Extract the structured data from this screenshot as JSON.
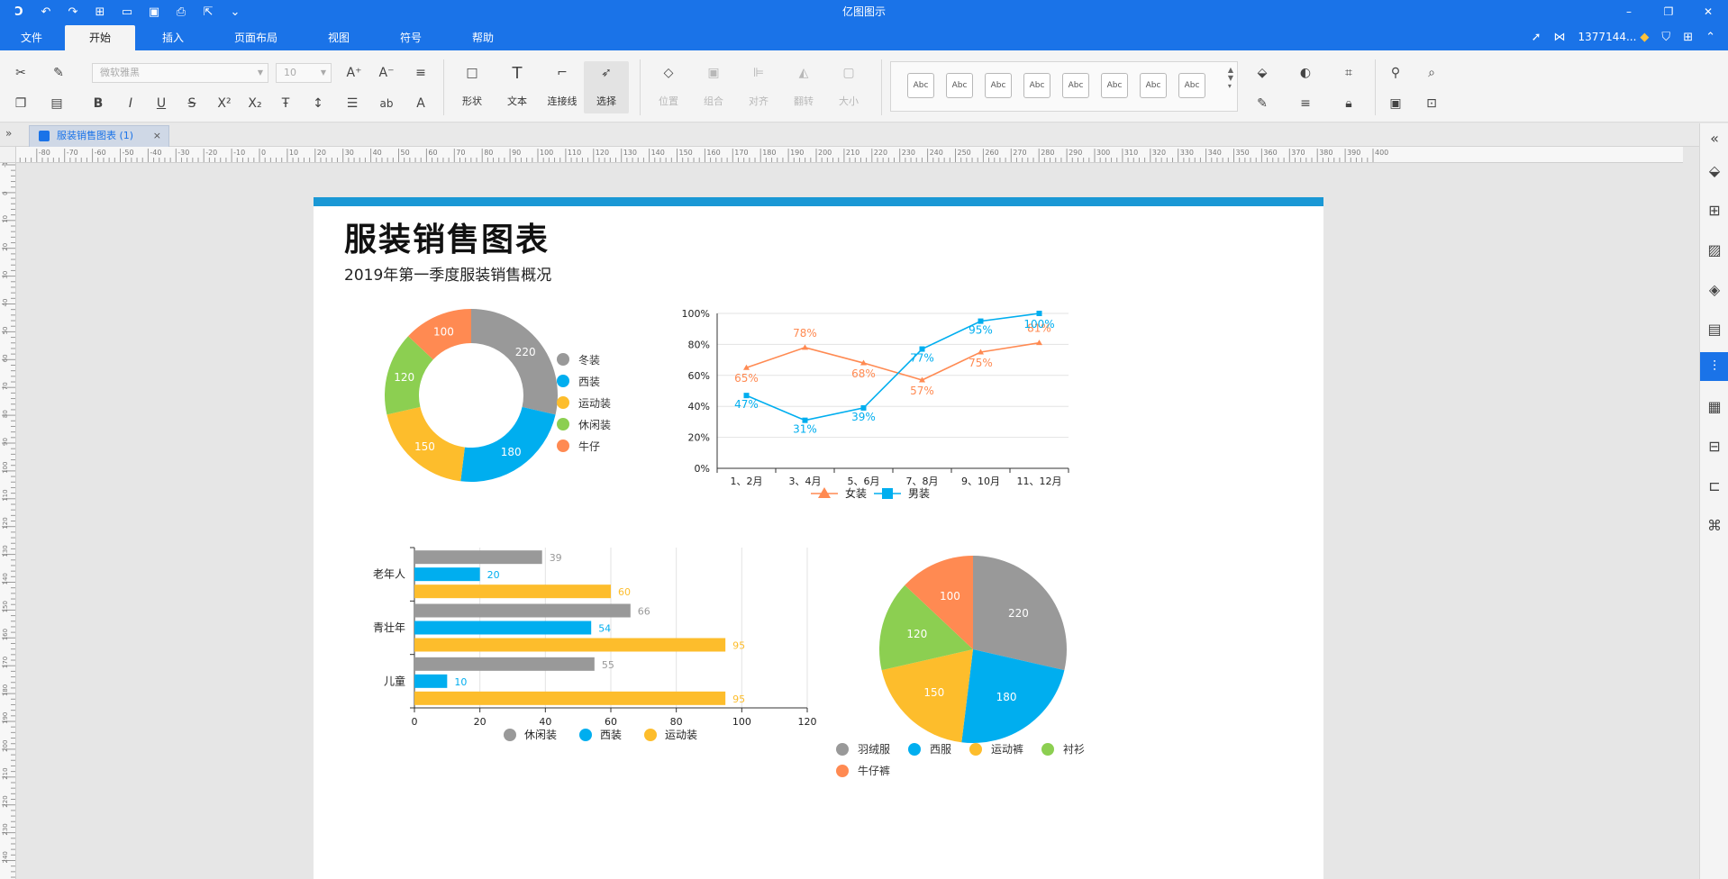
{
  "app": {
    "title": "亿图图示",
    "user": "1377144..."
  },
  "menu": {
    "tabs": [
      "文件",
      "开始",
      "插入",
      "页面布局",
      "视图",
      "符号",
      "帮助"
    ],
    "active": "开始"
  },
  "ribbon": {
    "font_name": "微软雅黑",
    "font_size": "10",
    "tools": {
      "shape": "形状",
      "text": "文本",
      "connector": "连接线",
      "select": "选择",
      "position": "位置",
      "group": "组合",
      "align": "对齐",
      "rotate": "翻转",
      "size": "大小"
    },
    "style_swatch_label": "Abc",
    "style_swatch_count": 8
  },
  "document": {
    "tab_title": "服装销售图表 (1)"
  },
  "page": {
    "title": "服装销售图表",
    "subtitle": "2019年第一季度服装销售概况"
  },
  "colors": {
    "gray": "#999999",
    "blue": "#00aeef",
    "yellow": "#fdbd2c",
    "green": "#8ccf51",
    "orange": "#ff8a52",
    "accent": "#1a73e8"
  },
  "chart_data": [
    {
      "type": "pie",
      "variant": "donut",
      "categories": [
        "冬装",
        "西装",
        "运动装",
        "休闲装",
        "牛仔"
      ],
      "values": [
        220,
        180,
        150,
        120,
        100
      ]
    },
    {
      "type": "line",
      "categories": [
        "1、2月",
        "3、4月",
        "5、6月",
        "7、8月",
        "9、10月",
        "11、12月"
      ],
      "series": [
        {
          "name": "女装",
          "values": [
            65,
            78,
            68,
            57,
            75,
            81
          ]
        },
        {
          "name": "男装",
          "values": [
            47,
            31,
            39,
            77,
            95,
            100
          ]
        }
      ],
      "ylim": [
        0,
        100
      ],
      "yticks": [
        "0%",
        "20%",
        "40%",
        "60%",
        "80%",
        "100%"
      ],
      "data_labels": [
        "65%",
        "78%",
        "68%",
        "57%",
        "75%",
        "81%",
        "47%",
        "31%",
        "39%",
        "77%",
        "95%",
        "100%"
      ],
      "legend": "bottom"
    },
    {
      "type": "bar",
      "orientation": "horizontal",
      "categories": [
        "老年人",
        "青壮年",
        "儿童"
      ],
      "series": [
        {
          "name": "休闲装",
          "values": [
            39,
            66,
            55
          ]
        },
        {
          "name": "西装",
          "values": [
            20,
            54,
            10
          ]
        },
        {
          "name": "运动装",
          "values": [
            60,
            95,
            95
          ]
        }
      ],
      "xlim": [
        0,
        120
      ],
      "xticks": [
        "0",
        "20",
        "40",
        "60",
        "80",
        "100",
        "120"
      ],
      "legend": "bottom"
    },
    {
      "type": "pie",
      "categories": [
        "羽绒服",
        "西服",
        "运动裤",
        "衬衫",
        "牛仔裤"
      ],
      "values": [
        220,
        180,
        150,
        120,
        100
      ],
      "legend": "bottom"
    }
  ]
}
